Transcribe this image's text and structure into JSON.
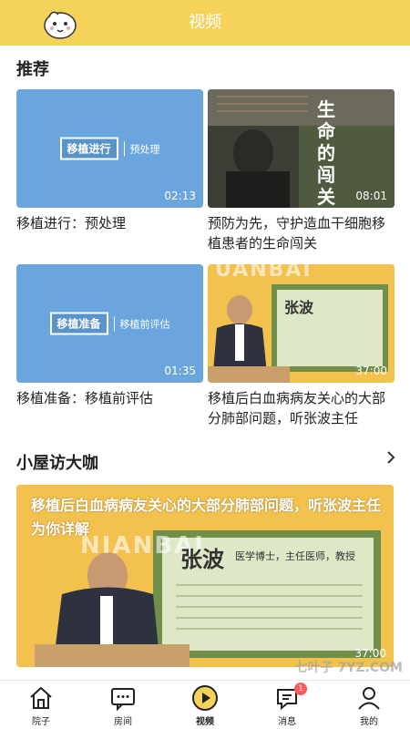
{
  "header": {
    "title": "视频",
    "logo_icon": "mascot-logo-icon"
  },
  "sections": {
    "recommend": {
      "title": "推荐"
    },
    "interview": {
      "title": "小屋访大咖"
    }
  },
  "videos": [
    {
      "tag": "移植进行",
      "tag_sub": "预处理",
      "duration": "02:13",
      "caption": "移植进行：预处理"
    },
    {
      "overlay": "生命的闯关",
      "duration": "08:01",
      "caption": "预防为先，守护造血干细胞移植患者的生命闯关"
    },
    {
      "tag": "移植准备",
      "tag_sub": "移植前评估",
      "duration": "01:35",
      "caption": "移植准备：移植前评估"
    },
    {
      "overlay_name": "张波",
      "overlay_brand": "UANBAI",
      "duration": "37:00",
      "caption": "移植后白血病病友关心的大部分肺部问题，听张波主任"
    }
  ],
  "banner": {
    "headline": "移植后白血病病友关心的大部分肺部问题，听张波主任为你详解",
    "overlay_name": "张波",
    "overlay_title": "医学博士，主任医师，教授",
    "overlay_brand": "NIANBAI",
    "duration": "37:00"
  },
  "tabs": [
    {
      "label": "院子",
      "icon": "house-icon"
    },
    {
      "label": "房间",
      "icon": "chat-room-icon"
    },
    {
      "label": "视频",
      "icon": "play-icon",
      "active": true
    },
    {
      "label": "消息",
      "icon": "message-icon",
      "badge": "1"
    },
    {
      "label": "我的",
      "icon": "user-icon"
    }
  ],
  "watermark": "七叶子 7YZ.COM",
  "colors": {
    "accent": "#f5d35b",
    "thumb_blue": "#6aa6dd",
    "badge": "#ff5a5a"
  }
}
